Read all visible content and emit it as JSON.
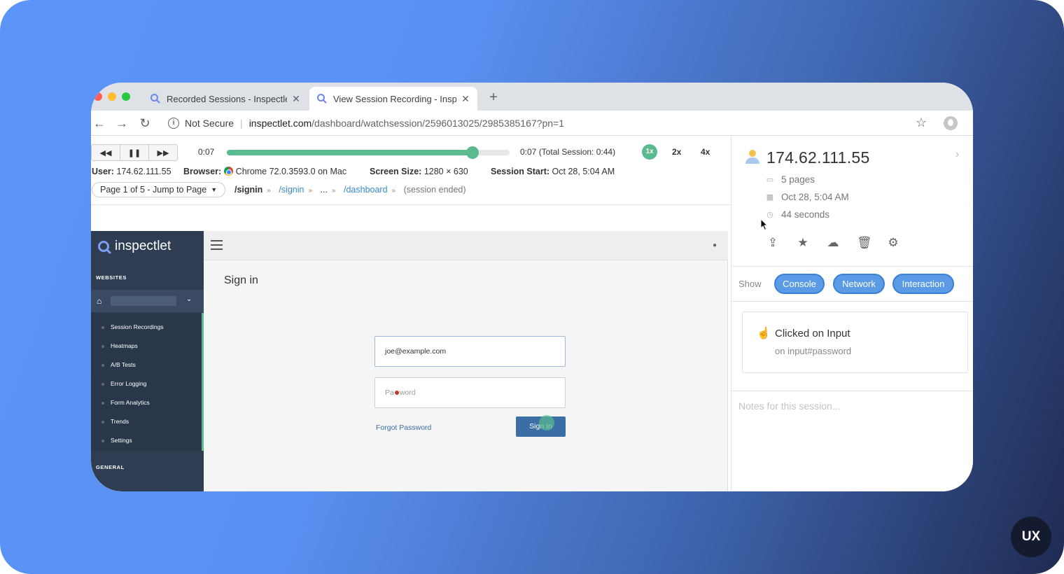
{
  "browser": {
    "tabs": [
      {
        "title": "Recorded Sessions - Inspectlet",
        "active": false
      },
      {
        "title": "View Session Recording - Inspectlet",
        "active": true
      }
    ],
    "address": {
      "security_label": "Not Secure",
      "url_host": "inspectlet.com",
      "url_path": "/dashboard/watchsession/2596013025/2985385167?pn=1"
    }
  },
  "player": {
    "current_time": "0:07",
    "total_time": "0:07 (Total Session: 0:44)",
    "progress_fraction": 0.87,
    "speeds": [
      {
        "label": "1x",
        "active": true
      },
      {
        "label": "2x",
        "active": false
      },
      {
        "label": "4x",
        "active": false
      }
    ],
    "meta": {
      "user_label": "User:",
      "user_value": "174.62.111.55",
      "browser_label": "Browser:",
      "browser_value": "Chrome 72.0.3593.0 on Mac",
      "screen_label": "Screen Size:",
      "screen_value": "1280 × 630",
      "start_label": "Session Start:",
      "start_value": "Oct 28, 5:04 AM"
    },
    "page_select": "Page 1 of 5 - Jump to Page",
    "breadcrumbs": [
      "/signin",
      "/signin",
      "...",
      "/dashboard",
      "(session ended)"
    ]
  },
  "recorded_site": {
    "logo": "inspectlet",
    "section_websites": "WEBSITES",
    "section_general": "GENERAL",
    "menu": [
      "Session Recordings",
      "Heatmaps",
      "A/B Tests",
      "Error Logging",
      "Form Analytics",
      "Trends",
      "Settings"
    ],
    "page_title": "Sign in",
    "email_value": "joe@example.com",
    "password_placeholder_a": "Pa",
    "password_placeholder_b": "word",
    "forgot_label": "Forgot Password",
    "signin_label": "Sign In"
  },
  "session_panel": {
    "ip": "174.62.111.55",
    "pages": "5 pages",
    "date": "Oct 28, 5:04 AM",
    "duration": "44 seconds",
    "show_label": "Show",
    "filters": [
      "Console",
      "Network",
      "Interaction"
    ],
    "event": {
      "title": "Clicked on Input",
      "detail": "on input#password"
    },
    "notes_placeholder": "Notes for this session..."
  },
  "badge": "UX",
  "colors": {
    "accent_green": "#59bb8f",
    "pill_blue": "#5b9be6",
    "sidebar_dark": "#2f3d52",
    "gradient_start": "#5b95f7",
    "gradient_end": "#1f2b52"
  }
}
